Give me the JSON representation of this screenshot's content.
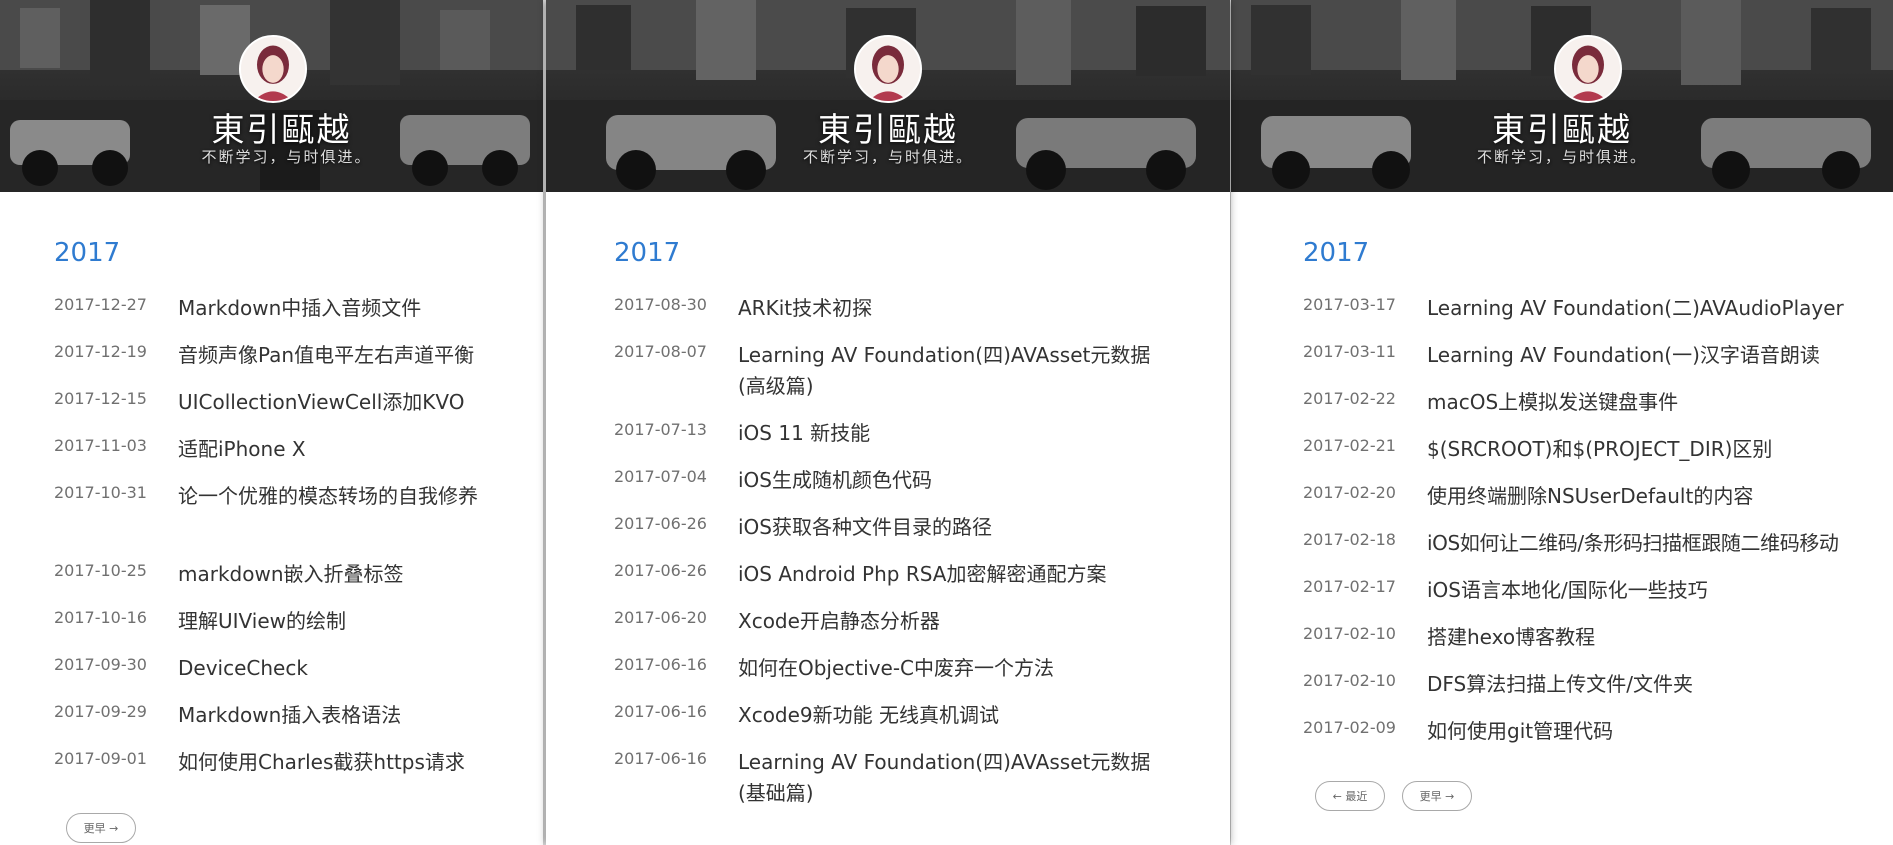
{
  "site": {
    "title": "東引甌越",
    "subtitle": "不断学习，与时俱进。"
  },
  "panels": [
    {
      "year": "2017",
      "posts": [
        {
          "date": "2017-12-27",
          "title": "Markdown中插入音频文件"
        },
        {
          "date": "2017-12-19",
          "title": "音频声像Pan值电平左右声道平衡"
        },
        {
          "date": "2017-12-15",
          "title": "UICollectionViewCell添加KVO"
        },
        {
          "date": "2017-11-03",
          "title": "适配iPhone X"
        },
        {
          "date": "2017-10-31",
          "title": "论一个优雅的模态转场的自我修养"
        },
        {
          "date": "2017-10-25",
          "title": "markdown嵌入折叠标签"
        },
        {
          "date": "2017-10-16",
          "title": "理解UIView的绘制"
        },
        {
          "date": "2017-09-30",
          "title": "DeviceCheck"
        },
        {
          "date": "2017-09-29",
          "title": "Markdown插入表格语法"
        },
        {
          "date": "2017-09-01",
          "title": "如何使用Charles截获https请求"
        }
      ],
      "pager": {
        "older": "更早 →"
      }
    },
    {
      "year": "2017",
      "posts": [
        {
          "date": "2017-08-30",
          "title": "ARKit技术初探"
        },
        {
          "date": "2017-08-07",
          "title": "Learning AV Foundation(四)AVAsset元数据(高级篇)"
        },
        {
          "date": "2017-07-13",
          "title": "iOS 11 新技能"
        },
        {
          "date": "2017-07-04",
          "title": "iOS生成随机颜色代码"
        },
        {
          "date": "2017-06-26",
          "title": "iOS获取各种文件目录的路径"
        },
        {
          "date": "2017-06-26",
          "title": "iOS Android Php RSA加密解密通配方案"
        },
        {
          "date": "2017-06-20",
          "title": "Xcode开启静态分析器"
        },
        {
          "date": "2017-06-16",
          "title": "如何在Objective-C中废弃一个方法"
        },
        {
          "date": "2017-06-16",
          "title": "Xcode9新功能 无线真机调试"
        },
        {
          "date": "2017-06-16",
          "title": "Learning AV Foundation(四)AVAsset元数据(基础篇)"
        }
      ]
    },
    {
      "year": "2017",
      "posts": [
        {
          "date": "2017-03-17",
          "title": "Learning AV Foundation(二)AVAudioPlayer"
        },
        {
          "date": "2017-03-11",
          "title": "Learning AV Foundation(一)汉字语音朗读"
        },
        {
          "date": "2017-02-22",
          "title": "macOS上模拟发送键盘事件"
        },
        {
          "date": "2017-02-21",
          "title": "$(SRCROOT)和$(PROJECT_DIR)区别"
        },
        {
          "date": "2017-02-20",
          "title": "使用终端删除NSUserDefault的内容"
        },
        {
          "date": "2017-02-18",
          "title": "iOS如何让二维码/条形码扫描框跟随二维码移动"
        },
        {
          "date": "2017-02-17",
          "title": "iOS语言本地化/国际化一些技巧"
        },
        {
          "date": "2017-02-10",
          "title": "搭建hexo博客教程"
        },
        {
          "date": "2017-02-10",
          "title": "DFS算法扫描上传文件/文件夹"
        },
        {
          "date": "2017-02-09",
          "title": "如何使用git管理代码"
        }
      ],
      "pager": {
        "newer": "← 最近",
        "older": "更早 →"
      }
    }
  ]
}
